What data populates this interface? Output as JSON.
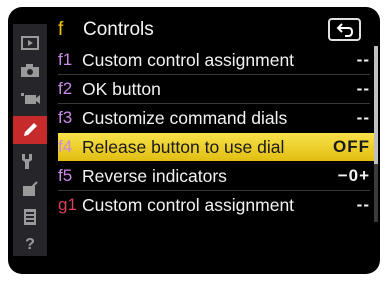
{
  "header": {
    "menu_glyph": "f",
    "title": "Controls",
    "back_icon": "return-arrow-icon"
  },
  "sidebar": {
    "items": [
      {
        "icon": "playback-icon"
      },
      {
        "icon": "camera-icon"
      },
      {
        "icon": "movie-icon"
      },
      {
        "icon": "pencil-icon",
        "active": true
      },
      {
        "icon": "wrench-icon"
      },
      {
        "icon": "retouch-icon"
      },
      {
        "icon": "my-menu-icon"
      },
      {
        "icon": "help-icon",
        "text": "?"
      }
    ]
  },
  "rows": [
    {
      "code_letter": "f",
      "code_num": "1",
      "label": "Custom control assignment",
      "value": "--",
      "code_color": "#c98ae6"
    },
    {
      "code_letter": "f",
      "code_num": "2",
      "label": "OK button",
      "value": "--",
      "code_color": "#c98ae6"
    },
    {
      "code_letter": "f",
      "code_num": "3",
      "label": "Customize command dials",
      "value": "--",
      "code_color": "#c98ae6"
    },
    {
      "code_letter": "f",
      "code_num": "4",
      "label": "Release button to use dial",
      "value": "OFF",
      "code_color": "#c98ae6",
      "selected": true
    },
    {
      "code_letter": "f",
      "code_num": "5",
      "label": "Reverse indicators",
      "value": "−0+",
      "code_color": "#c98ae6"
    },
    {
      "code_letter": "g",
      "code_num": "1",
      "label": "Custom control assignment",
      "value": "--",
      "code_color": "#d9415a"
    }
  ],
  "colors": {
    "highlight": "#f0d020",
    "active_tab": "#c62a2a",
    "background": "#000000"
  },
  "scroll": {
    "visible_fraction": 0.67
  }
}
